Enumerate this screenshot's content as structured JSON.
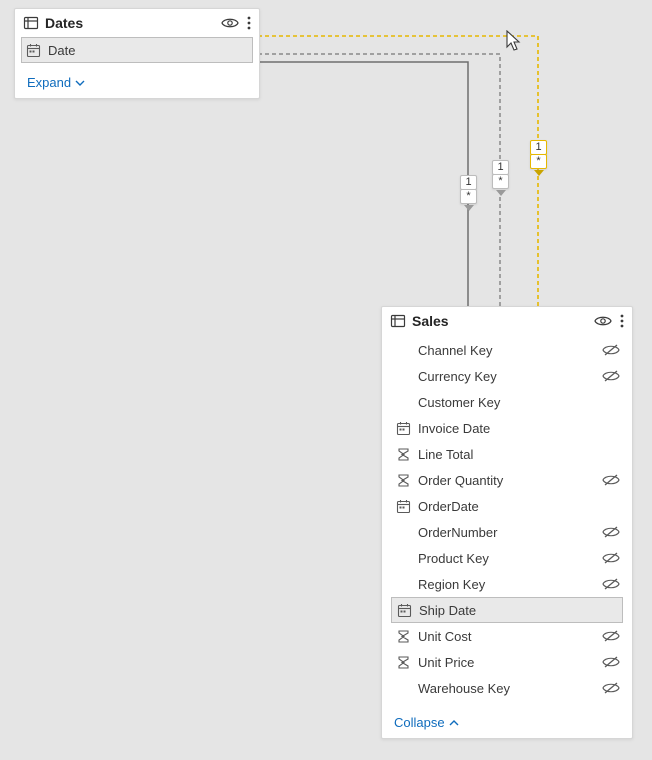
{
  "dates": {
    "title": "Dates",
    "fields": [
      {
        "label": "Date",
        "icon": "calendar",
        "selected": true,
        "hidden": false
      }
    ],
    "toggle_label": "Expand"
  },
  "sales": {
    "title": "Sales",
    "fields": [
      {
        "label": "Channel Key",
        "icon": "",
        "selected": false,
        "hidden": true
      },
      {
        "label": "Currency Key",
        "icon": "",
        "selected": false,
        "hidden": true
      },
      {
        "label": "Customer Key",
        "icon": "",
        "selected": false,
        "hidden": false
      },
      {
        "label": "Invoice Date",
        "icon": "calendar",
        "selected": false,
        "hidden": false
      },
      {
        "label": "Line Total",
        "icon": "sigma",
        "selected": false,
        "hidden": false
      },
      {
        "label": "Order Quantity",
        "icon": "sigma",
        "selected": false,
        "hidden": true
      },
      {
        "label": "OrderDate",
        "icon": "calendar",
        "selected": false,
        "hidden": false
      },
      {
        "label": "OrderNumber",
        "icon": "",
        "selected": false,
        "hidden": true
      },
      {
        "label": "Product Key",
        "icon": "",
        "selected": false,
        "hidden": true
      },
      {
        "label": "Region Key",
        "icon": "",
        "selected": false,
        "hidden": true
      },
      {
        "label": "Ship Date",
        "icon": "calendar",
        "selected": true,
        "hidden": false
      },
      {
        "label": "Unit Cost",
        "icon": "sigma",
        "selected": false,
        "hidden": true
      },
      {
        "label": "Unit Price",
        "icon": "sigma",
        "selected": false,
        "hidden": true
      },
      {
        "label": "Warehouse Key",
        "icon": "",
        "selected": false,
        "hidden": true
      }
    ],
    "toggle_label": "Collapse"
  },
  "relationships": [
    {
      "one": "1",
      "many": "*"
    },
    {
      "one": "1",
      "many": "*"
    },
    {
      "one": "1",
      "many": "*"
    }
  ]
}
